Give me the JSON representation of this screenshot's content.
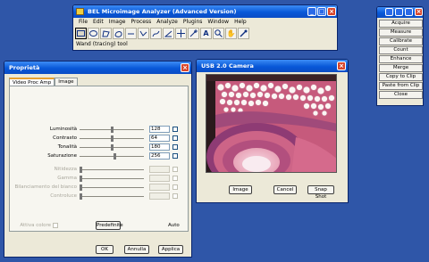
{
  "bel": {
    "title": "BEL Microimage Analyzer (Advanced Version)",
    "menus": [
      "File",
      "Edit",
      "Image",
      "Process",
      "Analyze",
      "Plugins",
      "Window",
      "Help"
    ],
    "tools": [
      "rectangle-tool-icon",
      "oval-tool-icon",
      "polygon-tool-icon",
      "freehand-tool-icon",
      "line-tool-icon",
      "segmented-line-tool-icon",
      "freehand-line-tool-icon",
      "angle-tool-icon",
      "point-tool-icon",
      "wand-tool-icon",
      "text-tool-icon",
      "magnifier-tool-icon",
      "hand-tool-icon",
      "dropper-tool-icon"
    ],
    "status": "Wand (tracing) tool"
  },
  "panel": {
    "buttons": [
      "Acquire",
      "Measure",
      "Calibrate",
      "Count",
      "Enhance",
      "Merge",
      "Copy to Clip",
      "Paste from Clip",
      "Close"
    ]
  },
  "prop": {
    "title": "Proprietà",
    "tabs": [
      "Video Proc Amp",
      "Image"
    ],
    "rows": [
      {
        "label": "Luminosità",
        "value": "128",
        "level": 0.5,
        "enabled": true
      },
      {
        "label": "Contrasto",
        "value": "64",
        "level": 0.5,
        "enabled": true
      },
      {
        "label": "Tonalità",
        "value": "180",
        "level": 0.5,
        "enabled": true
      },
      {
        "label": "Saturazione",
        "value": "256",
        "level": 0.55,
        "enabled": true
      },
      {
        "label": "Nitidezza",
        "value": "",
        "level": 0.0,
        "enabled": false
      },
      {
        "label": "Gamma",
        "value": "",
        "level": 0.0,
        "enabled": false
      },
      {
        "label": "Bilanciamento del bianco",
        "value": "",
        "level": 0.0,
        "enabled": false
      },
      {
        "label": "Controluce",
        "value": "",
        "level": 0.0,
        "enabled": false
      }
    ],
    "color_enable": "Attiva colore",
    "default_btn": "Predefinite",
    "auto": "Auto",
    "ok": "OK",
    "cancel": "Annulla",
    "apply": "Applica"
  },
  "cam": {
    "title": "USB 2.0 Camera",
    "image_btn": "Image",
    "cancel_btn": "Cancel",
    "snap_btn": "Snap Shot"
  },
  "colors": {
    "titlebar": "#0858d8",
    "desktop": "#2f56a8",
    "window": "#ece9d8",
    "close": "#d8462c"
  }
}
